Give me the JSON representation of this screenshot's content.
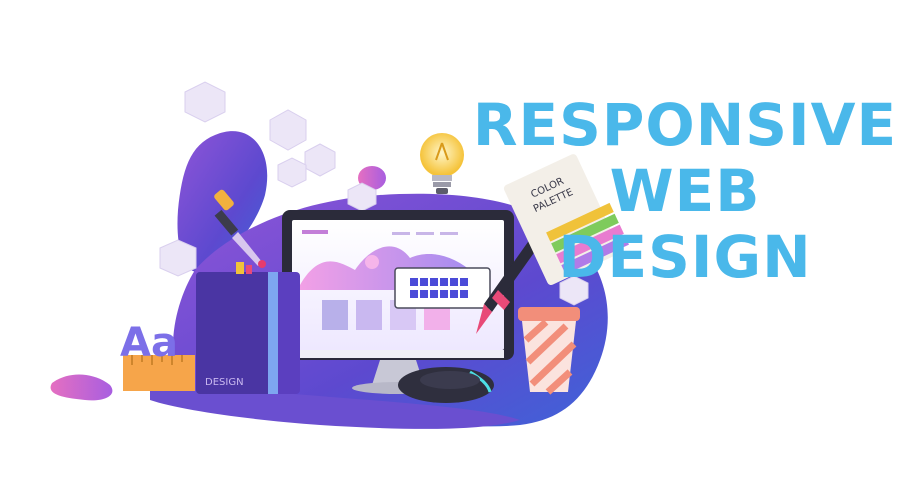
{
  "headline": {
    "line1": "RESPONSIVE",
    "line2": "WEB",
    "line3": "DESIGN"
  },
  "notebook": {
    "label": "DESIGN"
  },
  "palette_card": {
    "line1": "COLOR",
    "line2": "PALETTE"
  },
  "letters": {
    "text": "Aa"
  },
  "colors": {
    "headline": "#4ab8ea",
    "blob_purple": "#6a4fd0",
    "blob_pink": "#d878d8",
    "monitor": "#2b2b3a",
    "notebook": "#5b3fbf",
    "cup_stripe": "#f28e7a"
  }
}
